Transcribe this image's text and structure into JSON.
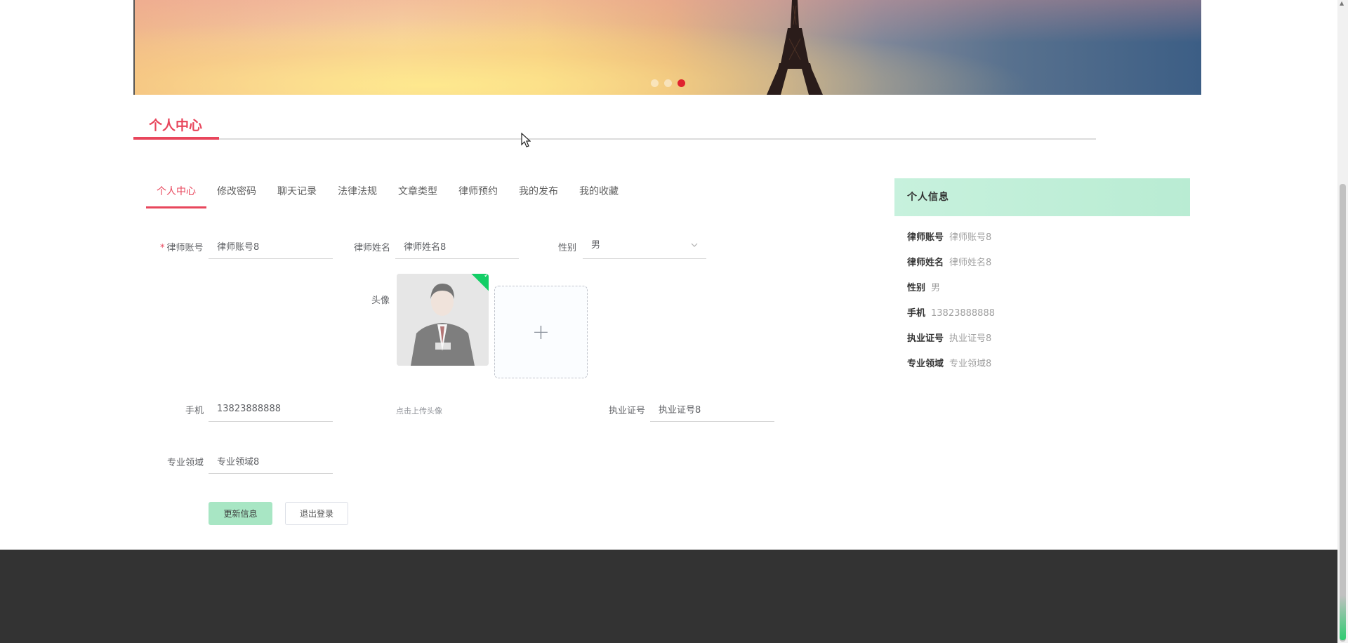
{
  "banner": {
    "slides_total": 3,
    "active_slide": 3
  },
  "section": {
    "title": "个人中心"
  },
  "tabs": [
    {
      "label": "个人中心",
      "active": true
    },
    {
      "label": "修改密码",
      "active": false
    },
    {
      "label": "聊天记录",
      "active": false
    },
    {
      "label": "法律法规",
      "active": false
    },
    {
      "label": "文章类型",
      "active": false
    },
    {
      "label": "律师预约",
      "active": false
    },
    {
      "label": "我的发布",
      "active": false
    },
    {
      "label": "我的收藏",
      "active": false
    }
  ],
  "form": {
    "account": {
      "label": "律师账号",
      "required_mark": "*",
      "value": "律师账号8"
    },
    "name": {
      "label": "律师姓名",
      "value": "律师姓名8"
    },
    "gender": {
      "label": "性别",
      "value": "男"
    },
    "avatar": {
      "label": "头像",
      "upload_tip": "点击上传头像",
      "add_icon": "+"
    },
    "phone": {
      "label": "手机",
      "value": "13823888888"
    },
    "license": {
      "label": "执业证号",
      "value": "执业证号8"
    },
    "field": {
      "label": "专业领域",
      "value": "专业领域8"
    },
    "update_button": "更新信息",
    "logout_button": "退出登录"
  },
  "info_panel": {
    "title": "个人信息",
    "rows": [
      {
        "key": "律师账号",
        "value": "律师账号8"
      },
      {
        "key": "律师姓名",
        "value": "律师姓名8"
      },
      {
        "key": "性别",
        "value": "男"
      },
      {
        "key": "手机",
        "value": "13823888888"
      },
      {
        "key": "执业证号",
        "value": "执业证号8"
      },
      {
        "key": "专业领域",
        "value": "专业领域8"
      }
    ]
  },
  "colors": {
    "accent": "#e8465c",
    "panel_header": "#c7f1dd",
    "update_button": "#a8e6c4",
    "footer": "#333333"
  }
}
